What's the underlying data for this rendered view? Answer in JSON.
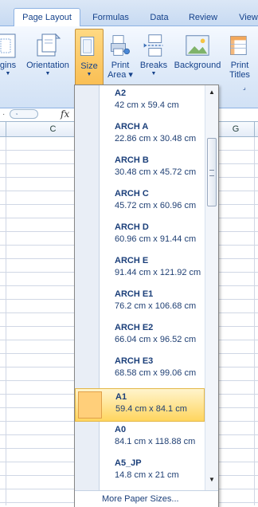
{
  "ribbon": {
    "tabs": [
      {
        "label": "Page Layout",
        "active": true
      },
      {
        "label": "Formulas",
        "active": false
      },
      {
        "label": "Data",
        "active": false
      },
      {
        "label": "Review",
        "active": false
      },
      {
        "label": "View",
        "active": false
      }
    ],
    "buttons": {
      "margins": {
        "label": "gins",
        "icon": "margins-icon"
      },
      "orientation": {
        "label": "Orientation",
        "icon": "orientation-icon"
      },
      "size": {
        "label": "Size",
        "icon": "page-size-icon"
      },
      "print_area": {
        "label": "Print",
        "sublabel": "Area",
        "icon": "print-area-icon"
      },
      "breaks": {
        "label": "Breaks",
        "icon": "breaks-icon"
      },
      "background": {
        "label": "Background",
        "icon": "background-icon"
      },
      "print_titles": {
        "label": "Print",
        "sublabel": "Titles",
        "icon": "print-titles-icon"
      }
    }
  },
  "formula_bar": {
    "fx_label": "fx"
  },
  "grid": {
    "columns": [
      "C",
      "G"
    ]
  },
  "size_menu": {
    "items": [
      {
        "name": "A2",
        "dims": "42 cm x 59.4 cm",
        "selected": false
      },
      {
        "name": "ARCH A",
        "dims": "22.86 cm x 30.48 cm",
        "selected": false
      },
      {
        "name": "ARCH B",
        "dims": "30.48 cm x 45.72 cm",
        "selected": false
      },
      {
        "name": "ARCH C",
        "dims": "45.72 cm x 60.96 cm",
        "selected": false
      },
      {
        "name": "ARCH D",
        "dims": "60.96 cm x 91.44 cm",
        "selected": false
      },
      {
        "name": "ARCH E",
        "dims": "91.44 cm x 121.92 cm",
        "selected": false
      },
      {
        "name": "ARCH E1",
        "dims": "76.2 cm x 106.68 cm",
        "selected": false
      },
      {
        "name": "ARCH E2",
        "dims": "66.04 cm x 96.52 cm",
        "selected": false
      },
      {
        "name": "ARCH E3",
        "dims": "68.58 cm x 99.06 cm",
        "selected": false
      },
      {
        "name": "A1",
        "dims": "59.4 cm x 84.1 cm",
        "selected": true
      },
      {
        "name": "A0",
        "dims": "84.1 cm x 118.88 cm",
        "selected": false
      },
      {
        "name": "A5_JP",
        "dims": "14.8 cm x 21 cm",
        "selected": false
      }
    ],
    "more_label": "More Paper Sizes..."
  },
  "colors": {
    "accent": "#15428b",
    "selected_gradient_top": "#fff4cc",
    "selected_gradient_bottom": "#ffd55e",
    "ribbon_border": "#8db2e3"
  }
}
